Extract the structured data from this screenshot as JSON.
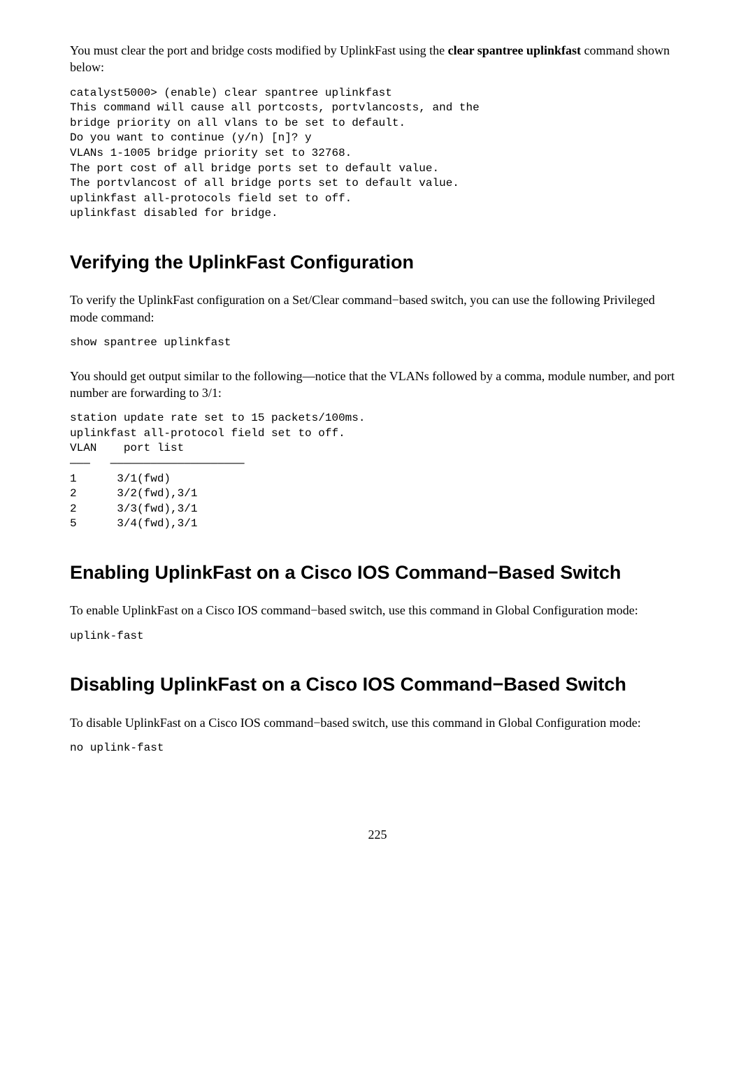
{
  "intro": {
    "part1": "You must clear the port and bridge costs modified by UplinkFast using the ",
    "bold": "clear spantree uplinkfast",
    "part2": " command shown below:"
  },
  "code1": "catalyst5000> (enable) clear spantree uplinkfast\nThis command will cause all portcosts, portvlancosts, and the\nbridge priority on all vlans to be set to default.\nDo you want to continue (y/n) [n]? y\nVLANs 1-1005 bridge priority set to 32768.\nThe port cost of all bridge ports set to default value.\nThe portvlancost of all bridge ports set to default value.\nuplinkfast all-protocols field set to off.\nuplinkfast disabled for bridge.",
  "section1": {
    "heading": "Verifying the UplinkFast Configuration",
    "para": "To verify the UplinkFast configuration on a Set/Clear command−based switch, you can use the following Privileged mode command:",
    "code": "show spantree uplinkfast",
    "para2": "You should get output similar to the following—notice that the VLANs followed by a comma, module number, and port number are forwarding to 3/1:",
    "code2": "station update rate set to 15 packets/100ms.\nuplinkfast all-protocol field set to off.\nVLAN    port list\n———   ————————————————————\n1      3/1(fwd)\n2      3/2(fwd),3/1\n2      3/3(fwd),3/1\n5      3/4(fwd),3/1"
  },
  "section2": {
    "heading": "Enabling UplinkFast on a Cisco IOS Command−Based Switch",
    "para": "To enable UplinkFast on a Cisco IOS command−based switch, use this command in Global Configuration mode:",
    "code": "uplink-fast"
  },
  "section3": {
    "heading": "Disabling UplinkFast on a Cisco IOS Command−Based Switch",
    "para": "To disable UplinkFast on a Cisco IOS command−based switch, use this command in Global Configuration mode:",
    "code": "no uplink-fast"
  },
  "page_number": "225"
}
